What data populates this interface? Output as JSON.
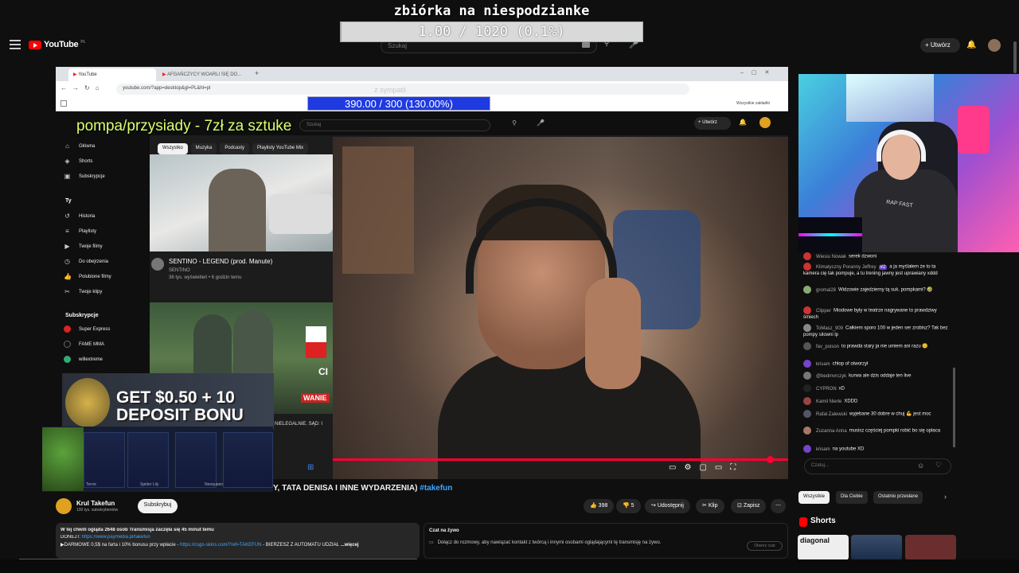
{
  "goal": {
    "title": "zbiórka na niespodzianke",
    "progress_text": "1.00 / 1020 (0.1%)",
    "progress_fraction": 0.001
  },
  "outer_header": {
    "logo": "YouTube",
    "logo_country": "PL",
    "search_placeholder": "Szukaj",
    "create_label": "Utwórz"
  },
  "browser": {
    "tab1": "YouTube",
    "tab2": "AFGAŃCZYCY WOARLI SIĘ DO...",
    "url": "youtube.com/?app=desktop&gl=PL&hl=pl",
    "bookmarks_all": "Wszystkie zakładki",
    "faded_text": "z sympatii"
  },
  "viewers_goal": {
    "text": "390.00 / 300 (130.00%)",
    "progress_fraction": 1.0
  },
  "overlay_pompa": "pompa/przysiady - 7zł za sztuke",
  "inner_header": {
    "search_placeholder": "Szukaj",
    "create_label": "Utwórz"
  },
  "inner_sidebar": {
    "items": [
      {
        "label": "Główna",
        "icon": "home-icon"
      },
      {
        "label": "Shorts",
        "icon": "shorts-icon"
      },
      {
        "label": "Subskrypcje",
        "icon": "subscriptions-icon"
      }
    ],
    "you_heading": "Ty",
    "you_items": [
      {
        "label": "Historia",
        "icon": "history-icon"
      },
      {
        "label": "Playlisty",
        "icon": "playlist-icon"
      },
      {
        "label": "Twoje filmy",
        "icon": "video-icon"
      },
      {
        "label": "Do obejrzenia",
        "icon": "clock-icon"
      },
      {
        "label": "Polubione filmy",
        "icon": "like-icon"
      },
      {
        "label": "Twoje klipy",
        "icon": "scissors-icon"
      }
    ],
    "subs_heading": "Subskrypcje",
    "subs_items": [
      {
        "label": "Super Express",
        "color": "#d22"
      },
      {
        "label": "FAME MMA",
        "color": "#111"
      },
      {
        "label": "willextreme",
        "color": "#3a7"
      }
    ]
  },
  "inner_chips": [
    "Wszystko",
    "Muzyka",
    "Podcasty",
    "Playlisty YouTube Mix"
  ],
  "feed_video": {
    "title": "SENTINO - LEGEND (prod. Manute)",
    "channel": "SENTINO",
    "meta": "36 tys. wyświetleń • 6 godzin temu"
  },
  "feed_video2_fragment": "NIELEGALNIE. SĄD: I",
  "feed_video2_overlay": [
    "CI",
    "WANIE"
  ],
  "ad": {
    "line1": "GET $0.50 + 10",
    "line2": "DEPOSIT BONU",
    "items": [
      "Terror",
      "Spider Lily",
      "Neoqueen",
      ""
    ]
  },
  "video_title": {
    "text": "Y, TATA DENISA I INNE WYDARZENIA) ",
    "tag": "#takefun"
  },
  "channel": {
    "name": "Krul Takefun",
    "subs": "100 tys. subskrybentów",
    "subscribe": "Subskrybuj"
  },
  "actions": {
    "likes": "398",
    "dislikes": "5",
    "share": "Udostępnij",
    "clip": "Klip",
    "save": "Zapisz"
  },
  "description": {
    "line1": "W tej chwili ogląda 2648 osób  Transmisja zaczęła się 45 minut temu",
    "line2_prefix": "DONEJT: ",
    "line2_link": "https://www.paymedia.pl/takefun",
    "line3_prefix": "▶DARMOWE 0,5$  na farta i 10% bonusu przy wpłacie - ",
    "line3_link": "https://csgo-skins.com/?ref=TAKEFUN",
    "line3_suffix": " - BIERZESZ Z AUTOMATU UDZIAŁ",
    "more": "...więcej"
  },
  "chat_replay": {
    "title": "Czat na żywo",
    "body": "Dołącz do rozmowy, aby nawiązać kontakt z twórcą i innymi osobami oglądającymi tę transmisję na żywo.",
    "button": "Otwórz czat"
  },
  "cam_shirt_text": "RAP FAST",
  "chat": {
    "messages": [
      {
        "name": "Wiesiu Nowak",
        "text": "serek dzwoni",
        "color": "#c33"
      },
      {
        "name": "Klimatyczny Poranny Jeffrey",
        "badge": "#2",
        "text": "a ja myślałem że to ta kamera cię tak pompuje, a tu trening jawny jest uprawiany xddd",
        "color": "#c33"
      },
      {
        "name": "gromal28",
        "text": "Widzowie zajedzierny tą suk. pompkami? 🤣",
        "color": "#8a7"
      },
      {
        "name": "Clipper",
        "text": "Miodowe były w teatrze nagrywane to prawdziwy śmiech",
        "color": "#c33"
      },
      {
        "name": "ToMasz_909",
        "text": "Całkiem sporo 100 w jeden ser zrobisz? Tak bez pompy silowni lp",
        "color": "#888"
      },
      {
        "name": "fav_poison",
        "text": "to prawda stary ja nie umiem ani razu 😊",
        "color": "#555"
      },
      {
        "name": "krisam",
        "text": "chłop of otworzył",
        "color": "#74c"
      },
      {
        "name": "@bedmvrczyk",
        "text": "kurwa ale dzis oddaje ten live",
        "color": "#777"
      },
      {
        "name": "CYPRON",
        "text": "xD",
        "color": "#222"
      },
      {
        "name": "Kamil Nierle",
        "text": "XDDD",
        "color": "#944"
      },
      {
        "name": "Rafał Zalewski",
        "text": "wyjebane 30 dobre w chuj 💪 jest moc",
        "color": "#556"
      },
      {
        "name": "Zuzanna Anna",
        "text": "musisz częściej pompki robić bo się opłaca",
        "color": "#a76"
      },
      {
        "name": "krisam",
        "text": "na youtube XD",
        "color": "#74c"
      }
    ],
    "input_placeholder": "Czatuj..."
  },
  "right_chips": [
    "Wszystkie",
    "Dla Ciebie",
    "Ostatnio przesłane"
  ],
  "shorts": {
    "label": "Shorts",
    "thumb1_text": "diagonal"
  }
}
